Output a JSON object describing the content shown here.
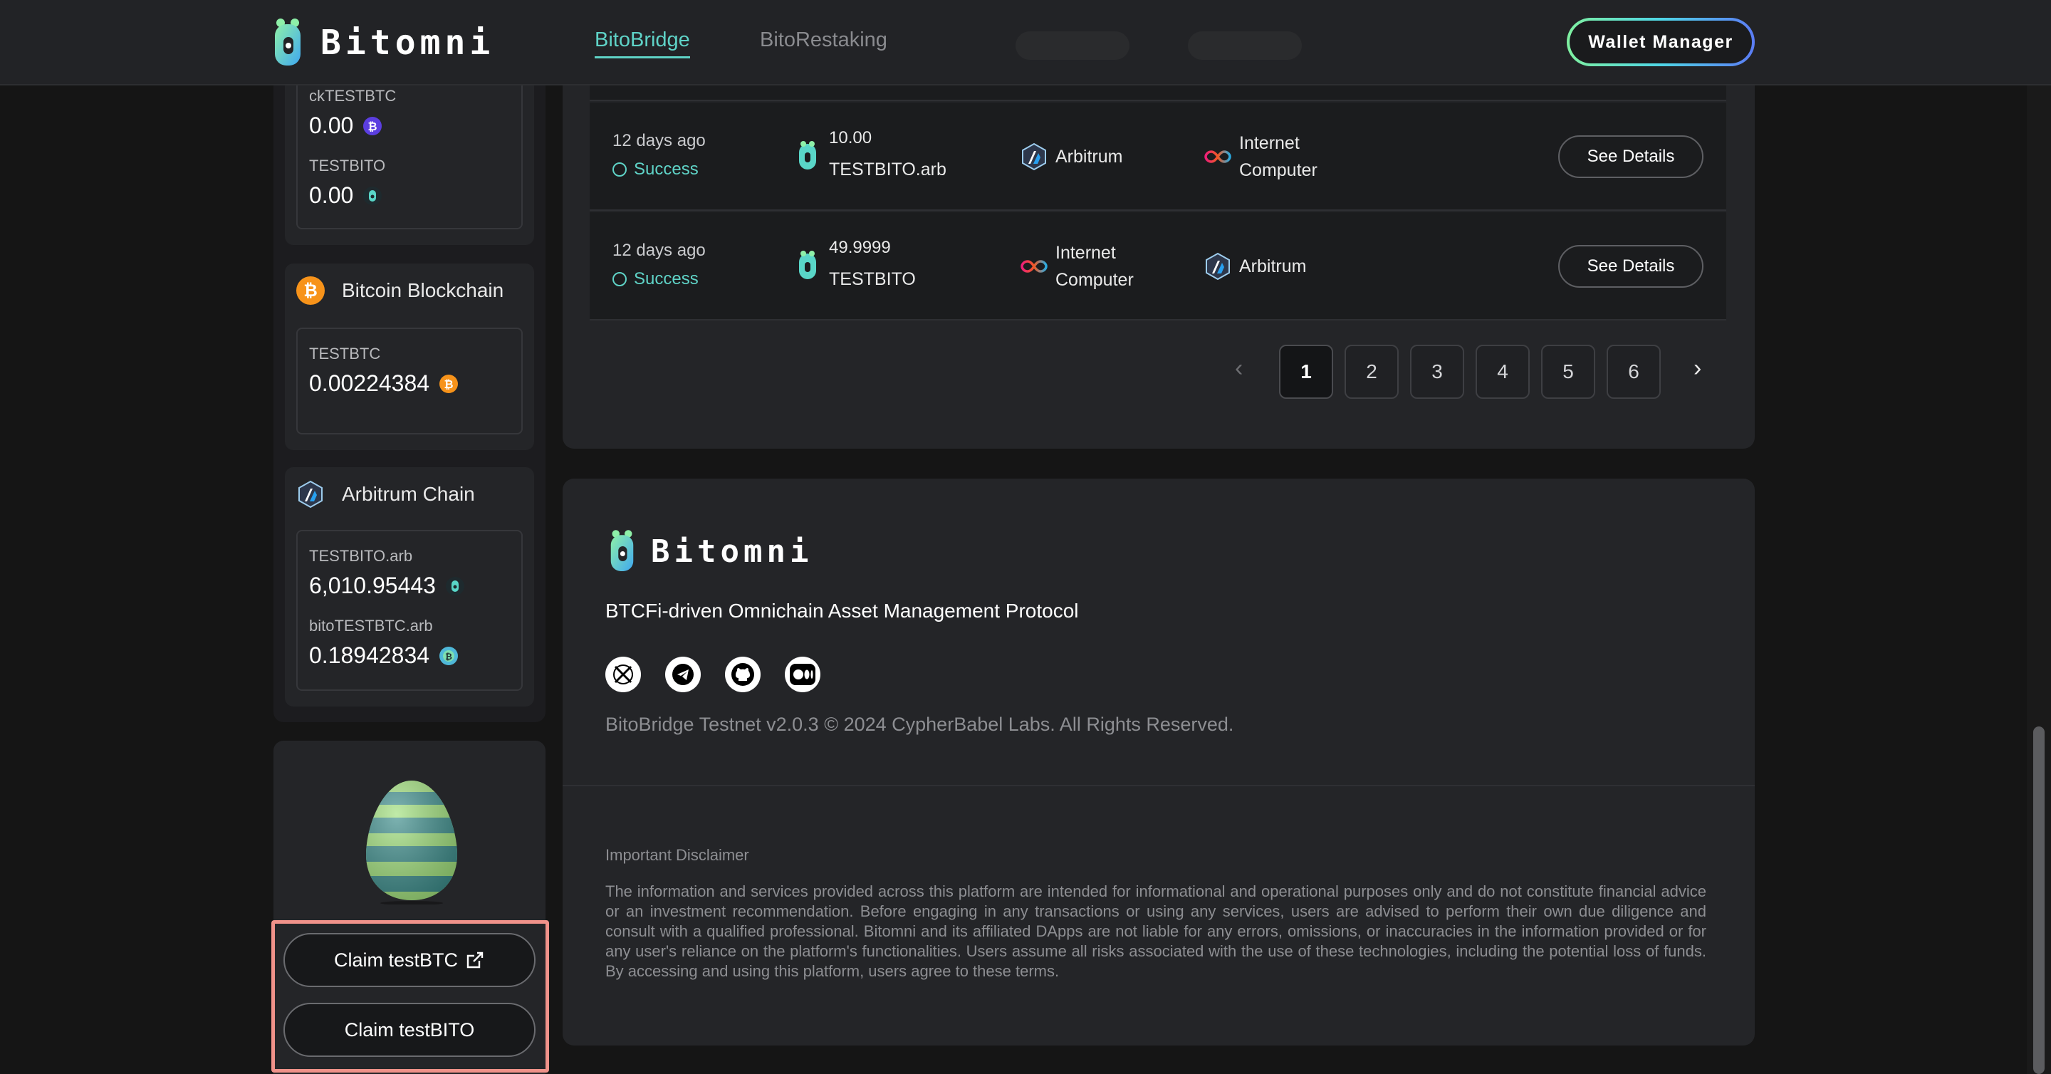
{
  "header": {
    "logo_text": "Bitomni",
    "nav": [
      {
        "label": "BitoBridge",
        "active": true
      },
      {
        "label": "BitoRestaking",
        "active": false
      }
    ],
    "wallet_button": "Wallet Manager"
  },
  "sidebar": {
    "ic_tokens": [
      {
        "name": "ckTESTBTC",
        "value": "0.00",
        "icon": "bitcoin-purple-icon"
      },
      {
        "name": "TESTBITO",
        "value": "0.00",
        "icon": "bito-icon"
      }
    ],
    "bitcoin": {
      "title": "Bitcoin Blockchain",
      "tokens": [
        {
          "name": "TESTBTC",
          "value": "0.00224384",
          "icon": "bitcoin-orange-icon"
        }
      ]
    },
    "arbitrum": {
      "title": "Arbitrum Chain",
      "tokens": [
        {
          "name": "TESTBITO.arb",
          "value": "6,010.95443",
          "icon": "bito-icon"
        },
        {
          "name": "bitoTESTBTC.arb",
          "value": "0.18942834",
          "icon": "bitobtc-icon"
        }
      ]
    },
    "claim_btc": "Claim testBTC",
    "claim_bito": "Claim testBITO"
  },
  "transactions": [
    {
      "time": "12 days ago",
      "status": "Success",
      "amount": "10.00",
      "token": "TESTBITO.arb",
      "from": "Arbitrum",
      "to_line1": "Internet",
      "to_line2": "Computer",
      "action": "See Details"
    },
    {
      "time": "12 days ago",
      "status": "Success",
      "amount": "49.9999",
      "token": "TESTBITO",
      "from_line1": "Internet",
      "from_line2": "Computer",
      "to": "Arbitrum",
      "action": "See Details"
    }
  ],
  "pagination": {
    "pages": [
      "1",
      "2",
      "3",
      "4",
      "5",
      "6"
    ],
    "current": "1",
    "prev": "‹",
    "next": "›"
  },
  "footer": {
    "logo_text": "Bitomni",
    "tagline": "BTCFi-driven Omnichain Asset Management Protocol",
    "social": [
      "x-icon",
      "telegram-icon",
      "github-icon",
      "medium-icon"
    ],
    "copyright": "BitoBridge Testnet v2.0.3 © 2024 CypherBabel Labs. All Rights Reserved.",
    "disclaimer_title": "Important Disclaimer",
    "disclaimer_body": "The information and services provided across this platform are intended for informational and operational purposes only and do not constitute financial advice or an investment recommendation. Before engaging in any transactions or using any services, users are advised to perform their own due diligence and consult with a qualified professional. Bitomni and its affiliated DApps are not liable for any errors, omissions, or inaccuracies in the information provided or for any user's reliance on the platform's functionalities. Users assume all risks associated with the use of these technologies, including the potential loss of funds. By accessing and using this platform, users agree to these terms."
  },
  "colors": {
    "accent": "#5fd3c7",
    "highlight": "#f0928a",
    "bitcoin": "#f7931a",
    "background": "#151515"
  }
}
